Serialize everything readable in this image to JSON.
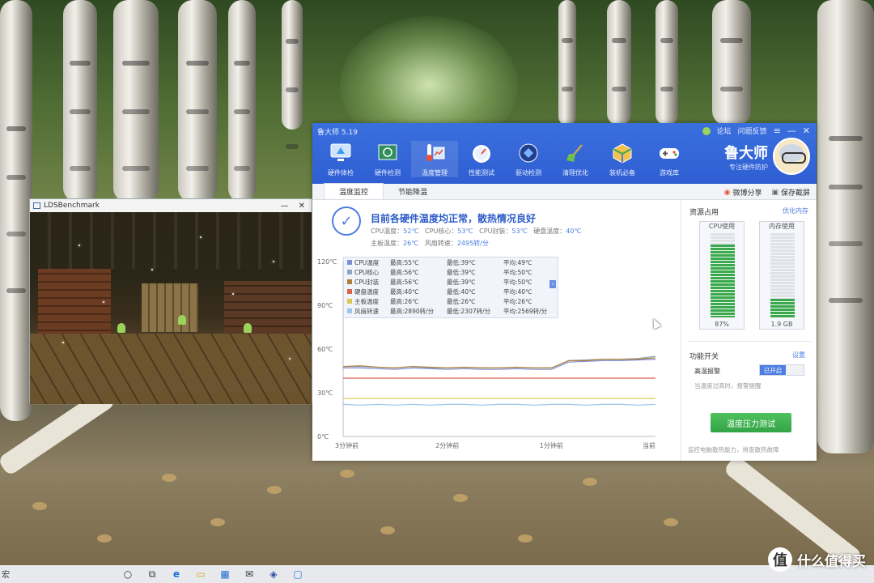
{
  "lds_window": {
    "title": "LDSBenchmark",
    "minimize": "—",
    "close": "✕"
  },
  "ludashi": {
    "title": "鲁大师 5.19",
    "top_links": [
      "论坛",
      "问题反馈"
    ],
    "window_controls": [
      "≡",
      "—",
      "✕"
    ],
    "nav": [
      {
        "label": "硬件体检",
        "icon": "health-check-icon"
      },
      {
        "label": "硬件检测",
        "icon": "hardware-detect-icon"
      },
      {
        "label": "温度管理",
        "icon": "temperature-icon",
        "active": true
      },
      {
        "label": "性能测试",
        "icon": "performance-gauge-icon"
      },
      {
        "label": "驱动检测",
        "icon": "driver-icon"
      },
      {
        "label": "清理优化",
        "icon": "broom-icon"
      },
      {
        "label": "装机必备",
        "icon": "package-icon"
      },
      {
        "label": "游戏库",
        "icon": "gamepad-icon"
      }
    ],
    "brand": {
      "name": "鲁大师",
      "slogan": "专注硬件防护"
    },
    "tabs": [
      "温度监控",
      "节能降温"
    ],
    "tab_actions": {
      "share": "微博分享",
      "screenshot": "保存截屏"
    },
    "status": {
      "check_mark": "✓",
      "title": "目前各硬件温度均正常，散热情况良好",
      "items": [
        {
          "label": "CPU温度：",
          "value": "52℃"
        },
        {
          "label": "CPU核心：",
          "value": "53℃"
        },
        {
          "label": "CPU封装：",
          "value": "53℃"
        },
        {
          "label": "硬盘温度：",
          "value": "40℃"
        },
        {
          "label": "主板温度：",
          "value": "26℃"
        },
        {
          "label": "风扇转速：",
          "value": "2495转/分"
        }
      ]
    },
    "chart_data": {
      "type": "line",
      "x_ticks": [
        "3分钟前",
        "2分钟前",
        "1分钟前",
        "当前"
      ],
      "y_ticks": [
        "120℃",
        "90℃",
        "60℃",
        "30℃",
        "0℃"
      ],
      "ylim": [
        0,
        120
      ],
      "x": [
        0,
        10,
        20,
        30,
        40,
        50,
        60,
        70,
        80,
        90,
        100,
        110,
        120,
        130,
        140,
        150,
        160,
        170,
        180
      ],
      "series": [
        {
          "name": "CPU温度",
          "color": "#7f8fd6",
          "max": "最高:55℃",
          "min": "最低:39℃",
          "avg": "平均:49℃",
          "values": [
            47,
            47,
            46.5,
            46,
            47,
            46.5,
            46,
            46.5,
            46,
            46,
            46.5,
            46,
            46,
            51,
            51.5,
            52,
            52,
            52.5,
            53
          ]
        },
        {
          "name": "CPU核心",
          "color": "#8fa6c0",
          "max": "最高:56℃",
          "min": "最低:39℃",
          "avg": "平均:50℃",
          "values": [
            48,
            48,
            47.5,
            47,
            48,
            47,
            47,
            47.5,
            47,
            47,
            47.5,
            47,
            47,
            52,
            52.5,
            53,
            53,
            53.5,
            55
          ]
        },
        {
          "name": "CPU封装",
          "color": "#b0803a",
          "max": "最高:56℃",
          "min": "最低:39℃",
          "avg": "平均:50℃",
          "values": [
            48,
            48.5,
            47.5,
            47,
            48,
            47.5,
            47,
            47.5,
            47,
            47,
            47.5,
            47,
            47,
            52,
            52,
            53,
            53,
            53,
            54
          ]
        },
        {
          "name": "硬盘温度",
          "color": "#d9644e",
          "max": "最高:40℃",
          "min": "最低:40℃",
          "avg": "平均:40℃",
          "values": [
            40,
            40,
            40,
            40,
            40,
            40,
            40,
            40,
            40,
            40,
            40,
            40,
            40,
            40,
            40,
            40,
            40,
            40,
            40
          ]
        },
        {
          "name": "主板温度",
          "color": "#d9c84e",
          "max": "最高:26℃",
          "min": "最低:26℃",
          "avg": "平均:26℃",
          "values": [
            26,
            26,
            26,
            26,
            26,
            26,
            26,
            26,
            26,
            26,
            26,
            26,
            26,
            26,
            26,
            26,
            26,
            26,
            26
          ]
        },
        {
          "name": "风扇转速",
          "color": "#9cc4ec",
          "max": "最高:2890转/分",
          "min": "最低:2307转/分",
          "avg": "平均:2569转/分",
          "values": [
            22,
            21.5,
            22,
            21.5,
            22,
            21.5,
            22,
            22,
            21.5,
            22,
            22,
            21.5,
            22,
            22,
            21.5,
            22,
            22,
            21.5,
            22
          ]
        }
      ]
    },
    "side": {
      "resource_title": "资源占用",
      "optimize_link": "优化内存",
      "cpu_label": "CPU使用",
      "cpu_value": "87%",
      "cpu_level": 0.87,
      "mem_label": "内存使用",
      "mem_value": "1.9 GB",
      "mem_level": 0.22,
      "switch_title": "功能开关",
      "settings_link": "设置",
      "alarm_label": "高温报警",
      "alarm_state": "已开启",
      "alarm_note": "当温度过高时，报警提醒",
      "stress_button": "温度压力测试",
      "stress_note": "监控电脑散热能力，排查散热故障"
    }
  },
  "taskbar": {
    "left_text": "宏",
    "items": [
      {
        "icon": "cortana-circle-icon",
        "glyph": "○"
      },
      {
        "icon": "task-view-icon",
        "glyph": "⧉"
      },
      {
        "icon": "edge-browser-icon",
        "glyph": "e"
      },
      {
        "icon": "file-explorer-icon",
        "glyph": "▭"
      },
      {
        "icon": "store-icon",
        "glyph": "▦"
      },
      {
        "icon": "mail-icon",
        "glyph": "✉"
      },
      {
        "icon": "app-icon",
        "glyph": "◈"
      },
      {
        "icon": "monitor-icon",
        "glyph": "▢"
      }
    ]
  },
  "watermark": {
    "badge": "值",
    "text": "什么值得买"
  }
}
